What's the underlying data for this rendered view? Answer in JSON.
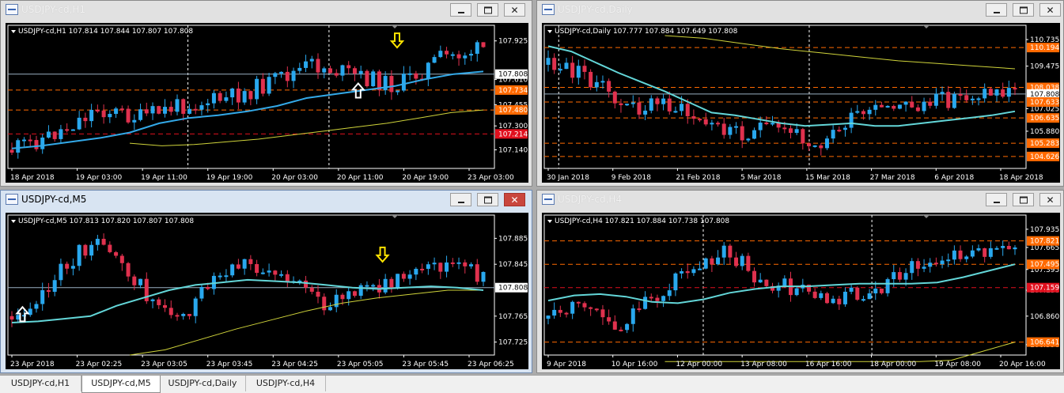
{
  "windows": [
    {
      "id": "h1",
      "title": "USDJPY-cd,H1",
      "active": false,
      "close_red": false,
      "info": "USDJPY-cd,H1  107.814 107.844 107.807 107.808",
      "axis_prices": [
        "107.925",
        "107.610",
        "107.455",
        "107.300",
        "107.140"
      ],
      "marker_prices": [
        {
          "text": "107.808",
          "kind": "current"
        },
        {
          "text": "107.734",
          "kind": "orange"
        },
        {
          "text": "107.480",
          "kind": "orange"
        },
        {
          "text": "107.214",
          "kind": "red"
        }
      ],
      "time_labels": [
        "18 Apr 2018",
        "19 Apr 03:00",
        "19 Apr 11:00",
        "19 Apr 19:00",
        "20 Apr 03:00",
        "20 Apr 11:00",
        "20 Apr 19:00",
        "23 Apr 03:00"
      ],
      "markers": {
        "up_arrow": true,
        "down_arrow": true
      }
    },
    {
      "id": "daily",
      "title": "USDJPY-cd,Daily",
      "active": false,
      "close_red": false,
      "info": "USDJPY-cd,Daily  107.777 107.884 107.649 107.808",
      "axis_prices": [
        "110.735",
        "109.475",
        "107.025",
        "105.880"
      ],
      "marker_prices": [
        {
          "text": "110.194",
          "kind": "orange"
        },
        {
          "text": "108.038",
          "kind": "orange"
        },
        {
          "text": "107.808",
          "kind": "current"
        },
        {
          "text": "107.633",
          "kind": "orange"
        },
        {
          "text": "106.635",
          "kind": "orange"
        },
        {
          "text": "105.283",
          "kind": "orange"
        },
        {
          "text": "104.626",
          "kind": "orange"
        }
      ],
      "time_labels": [
        "30 Jan 2018",
        "9 Feb 2018",
        "21 Feb 2018",
        "5 Mar 2018",
        "15 Mar 2018",
        "27 Mar 2018",
        "6 Apr 2018",
        "18 Apr 2018"
      ],
      "markers": {
        "up_arrow": false,
        "down_arrow": false
      }
    },
    {
      "id": "m5",
      "title": "USDJPY-cd,M5",
      "active": true,
      "close_red": true,
      "info": "USDJPY-cd,M5  107.813 107.820 107.807 107.808",
      "axis_prices": [
        "107.885",
        "107.845",
        "107.765",
        "107.725"
      ],
      "marker_prices": [
        {
          "text": "107.808",
          "kind": "current"
        }
      ],
      "time_labels": [
        "23 Apr 2018",
        "23 Apr 02:25",
        "23 Apr 03:05",
        "23 Apr 03:45",
        "23 Apr 04:25",
        "23 Apr 05:05",
        "23 Apr 05:45",
        "23 Apr 06:25"
      ],
      "markers": {
        "up_arrow": true,
        "down_arrow": true
      }
    },
    {
      "id": "h4",
      "title": "USDJPY-cd,H4",
      "active": false,
      "close_red": false,
      "info": "USDJPY-cd,H4  107.821 107.884 107.738 107.808",
      "axis_prices": [
        "107.935",
        "107.665",
        "107.395",
        "107.130",
        "106.860",
        "106.590"
      ],
      "marker_prices": [
        {
          "text": "107.821",
          "kind": "orange"
        },
        {
          "text": "107.495",
          "kind": "orange"
        },
        {
          "text": "107.159",
          "kind": "red"
        },
        {
          "text": "106.641",
          "kind": "orange"
        }
      ],
      "time_labels": [
        "9 Apr 2018",
        "10 Apr 16:00",
        "12 Apr 00:00",
        "13 Apr 08:00",
        "16 Apr 16:00",
        "18 Apr 00:00",
        "19 Apr 08:00",
        "20 Apr 16:00"
      ],
      "markers": {
        "up_arrow": false,
        "down_arrow": false
      }
    }
  ],
  "tabs": [
    {
      "label": "USDJPY-cd,H1",
      "active": false
    },
    {
      "label": "USDJPY-cd,M5",
      "active": true
    },
    {
      "label": "USDJPY-cd,Daily",
      "active": false
    },
    {
      "label": "USDJPY-cd,H4",
      "active": false
    }
  ],
  "colors": {
    "bull": "#29a8ee",
    "bear": "#e0314e",
    "ma_fast_h1": "#33a9e8",
    "ma_fast": "#63d6d8",
    "ma_slow": "#cfd33a",
    "level_orange": "#ff6a00",
    "level_red": "#e0101e",
    "current_line": "#9ab0c2",
    "arrow_up": "#ffffff",
    "arrow_down": "#ffe400"
  }
}
